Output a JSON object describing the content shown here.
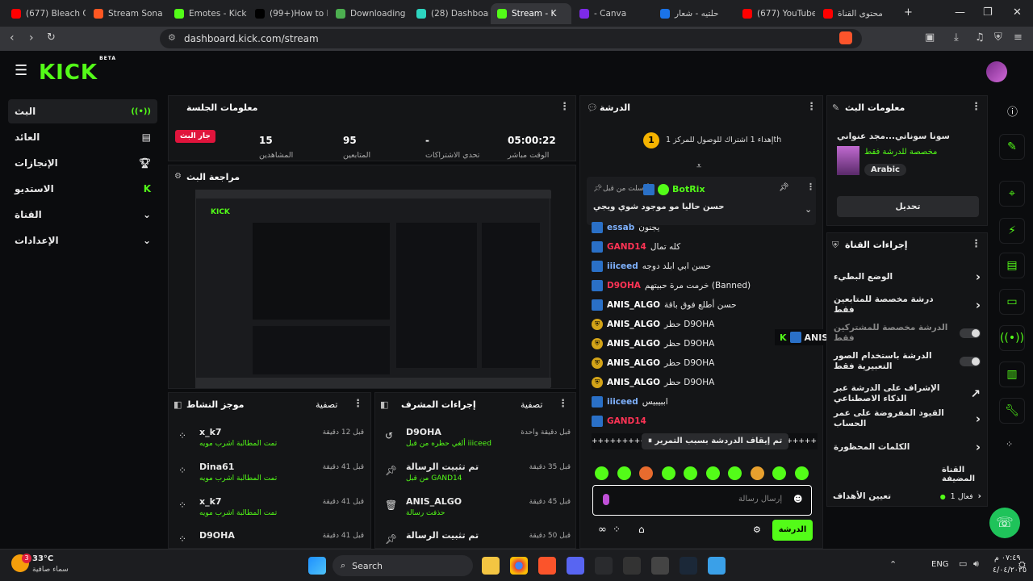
{
  "browser": {
    "tabs": [
      {
        "label": "(677) Bleach C",
        "color": "#ff0000"
      },
      {
        "label": "Stream Sona |",
        "color": "#ff5722"
      },
      {
        "label": "Emotes - Kick",
        "color": "#53fc18"
      },
      {
        "label": "(99+)How to D",
        "color": "#000000"
      },
      {
        "label": "Downloading",
        "color": "#4caf50"
      },
      {
        "label": "(28) Dashboar",
        "color": "#2dd4bf"
      },
      {
        "label": "Stream - K",
        "color": "#53fc18"
      },
      {
        "label": "- Canva",
        "color": "#7d2ae8"
      },
      {
        "label": "حلتيه - شعار",
        "color": "#1a73e8"
      },
      {
        "label": "(677) YouTube",
        "color": "#ff0000"
      },
      {
        "label": "محتوى القناة",
        "color": "#ff0000"
      }
    ],
    "url": "dashboard.kick.com/stream"
  },
  "brand": {
    "logo": "KICK",
    "beta": "BETA",
    "accent": "#53fc18"
  },
  "sidebar": {
    "items": [
      {
        "label": "البث",
        "icon": "live-icon"
      },
      {
        "label": "العائد",
        "icon": "revenue-icon"
      },
      {
        "label": "الإنجازات",
        "icon": "trophy-icon"
      },
      {
        "label": "الاستديو",
        "icon": "studio-icon"
      },
      {
        "label": "القناة",
        "icon": "channel-icon"
      },
      {
        "label": "الإعدادات",
        "icon": "gear-icon"
      }
    ]
  },
  "session": {
    "title": "معلومات الجلسة",
    "live": "جار البث",
    "stats": [
      {
        "value": "15",
        "label": "المشاهدين"
      },
      {
        "value": "95",
        "label": "المتابعين"
      },
      {
        "value": "-",
        "label": "تحدي الاشتراكات"
      },
      {
        "value": "05:00:22",
        "label": "الوقت مباشر"
      }
    ]
  },
  "preview": {
    "title": "مراجعة البث"
  },
  "chat": {
    "title": "الدرشة",
    "goal_badge": "1",
    "goal": "إهداء 1 اشتراك للوصول للمركز 1th",
    "pinned_by": "أرسلت من قبل",
    "pinned_user": "BotRix",
    "pinned_text": "حسن حاليا مو موجود شوي ويجي",
    "messages": [
      {
        "user": "essab",
        "text": "يجنون",
        "color": "#7fb2ff",
        "badge": "k"
      },
      {
        "user": "GAND14",
        "text": "كله تمال",
        "color": "#ff3355",
        "badge": "k"
      },
      {
        "user": "iiiceed",
        "text": "حسن ابي ابلد دوجه",
        "color": "#7fb2ff",
        "badge": "k"
      },
      {
        "user": "D9OHA",
        "text": "خرمت مرة حبيتهم (Banned)",
        "color": "#ff3355",
        "badge": "k"
      },
      {
        "user": "ANIS_ALGO",
        "text": "حسن أطلع فوق باقة",
        "color": "#ffffff",
        "badge": "k"
      },
      {
        "user": "ANIS_ALGO",
        "text": "حظر D9OHA",
        "color": "#ffffff",
        "badge": "m"
      },
      {
        "user": "ANIS_ALGO",
        "text": "حظر D9OHA",
        "color": "#ffffff",
        "badge": "m"
      },
      {
        "user": "ANIS_ALGO",
        "text": "حظر D9OHA",
        "color": "#ffffff",
        "badge": "m"
      },
      {
        "user": "ANIS_ALGO",
        "text": "حظر D9OHA",
        "color": "#ffffff",
        "badge": "m"
      },
      {
        "user": "iiiceed",
        "text": "اببيبيس",
        "color": "#7fb2ff",
        "badge": "k"
      },
      {
        "user": "GAND14",
        "text": "",
        "color": "#ff3355",
        "badge": "k"
      }
    ],
    "paused": "تم إيقاف الدردشة بسبب التمرير",
    "input_placeholder": "إرسال رسالة",
    "send": "الدرشة",
    "floating_user": "ANIS_ALGO"
  },
  "stream_info": {
    "title": "معلومات البث",
    "name": "سونا سوناتي...مجد عنواني",
    "category": "مخصصة للدرشة فقط",
    "language": "Arabic",
    "edit": "تحديل"
  },
  "channel_actions": {
    "title": "إجراءات القناة",
    "items": [
      {
        "label": "الوضع البطيء",
        "kind": "chevron"
      },
      {
        "label": "درشة مخصصة للمتابعين فقط",
        "kind": "chevron"
      },
      {
        "label": "الدرشة مخصصة للمشتركين فقط",
        "kind": "toggle"
      },
      {
        "label": "الدرشة باستخدام الصور التعبيرية فقط",
        "kind": "toggle"
      },
      {
        "label": "الإشراف على الدرشة عبر الذكاء الاصطناعي",
        "kind": "link"
      },
      {
        "label": "القيود المفروضة على عمر الحساب",
        "kind": "chevron"
      },
      {
        "label": "الكلمات المحظورة",
        "kind": "chevron"
      }
    ],
    "pinned_channel": "القناة المضيفة",
    "goals": "تعيين الأهداف",
    "goals_state": "فعال 1"
  },
  "activity": {
    "title": "موجز النشاط",
    "filter": "تصفية",
    "rows": [
      {
        "name": "x_k7",
        "sub": "تمت المطالبة اشرب مويه",
        "time": "قبل 12 دقيقة"
      },
      {
        "name": "Dina61",
        "sub": "تمت المطالبة اشرب مويه",
        "time": "قبل 41 دقيقة"
      },
      {
        "name": "x_k7",
        "sub": "تمت المطالبة اشرب مويه",
        "time": "قبل 41 دقيقة"
      },
      {
        "name": "D9OHA",
        "sub": "",
        "time": "قبل 41 دقيقة"
      }
    ]
  },
  "mod": {
    "title": "إجراءات المشرف",
    "filter": "تصفية",
    "rows": [
      {
        "name": "D9OHA",
        "sub": "ألغي حظره من قبل iiiceed",
        "time": "قبل دقيقة واحدة",
        "icon": "undo-icon"
      },
      {
        "name": "تم تثبيت الرسالة",
        "sub": "من قبل GAND14",
        "time": "قبل 35 دقيقة",
        "icon": "pin-icon"
      },
      {
        "name": "ANIS_ALGO",
        "sub": "حذفت رسالة",
        "time": "قبل 45 دقيقة",
        "icon": "trash-icon"
      },
      {
        "name": "تم تثبيت الرسالة",
        "sub": "",
        "time": "قبل 50 دقيقة",
        "icon": "pin-icon"
      }
    ]
  },
  "taskbar": {
    "temp": "33°C",
    "weather": "سماء صافية",
    "search": "Search",
    "lang": "ENG",
    "time": "٠٧:٤٩ م",
    "date": "٤/٠٤/٢٠٢٥",
    "badge": "3"
  }
}
